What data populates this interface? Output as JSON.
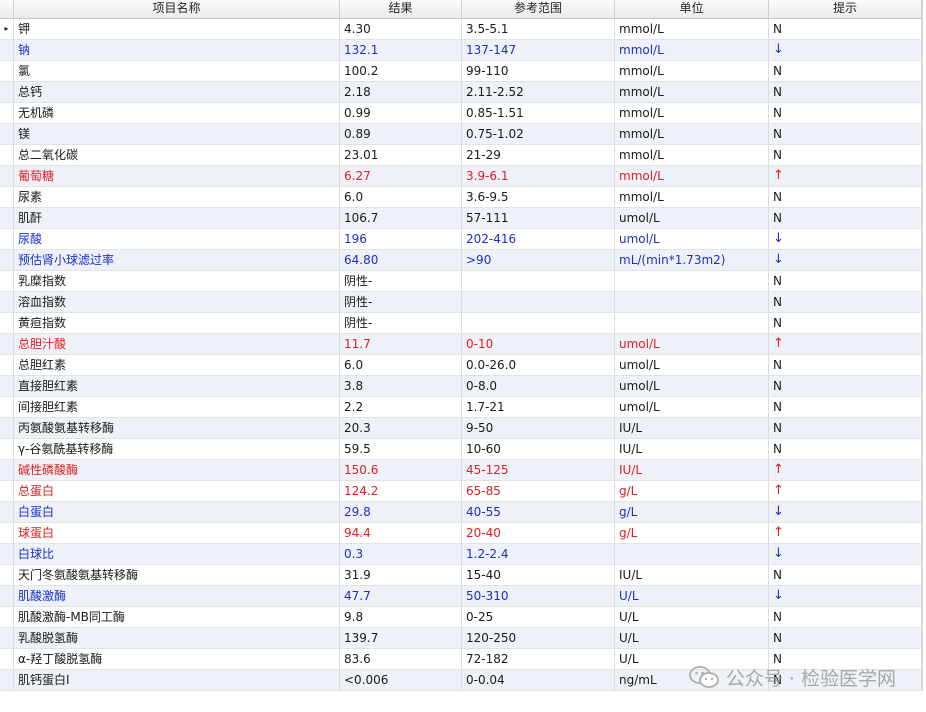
{
  "columns": {
    "name": "项目名称",
    "result": "结果",
    "reference": "参考范围",
    "unit": "单位",
    "hint": "提示"
  },
  "row_indicator": "▸",
  "rows": [
    {
      "name": "钾",
      "result": "4.30",
      "reference": "3.5-5.1",
      "unit": "mmol/L",
      "hint": "N",
      "flag": "normal"
    },
    {
      "name": "钠",
      "result": "132.1",
      "reference": "137-147",
      "unit": "mmol/L",
      "hint": "↓",
      "flag": "low"
    },
    {
      "name": "氯",
      "result": "100.2",
      "reference": "99-110",
      "unit": "mmol/L",
      "hint": "N",
      "flag": "normal"
    },
    {
      "name": "总钙",
      "result": "2.18",
      "reference": "2.11-2.52",
      "unit": "mmol/L",
      "hint": "N",
      "flag": "normal"
    },
    {
      "name": "无机磷",
      "result": "0.99",
      "reference": "0.85-1.51",
      "unit": "mmol/L",
      "hint": "N",
      "flag": "normal"
    },
    {
      "name": "镁",
      "result": "0.89",
      "reference": "0.75-1.02",
      "unit": "mmol/L",
      "hint": "N",
      "flag": "normal"
    },
    {
      "name": "总二氧化碳",
      "result": "23.01",
      "reference": "21-29",
      "unit": "mmol/L",
      "hint": "N",
      "flag": "normal"
    },
    {
      "name": "葡萄糖",
      "result": "6.27",
      "reference": "3.9-6.1",
      "unit": "mmol/L",
      "hint": "↑",
      "flag": "high"
    },
    {
      "name": "尿素",
      "result": "6.0",
      "reference": "3.6-9.5",
      "unit": "mmol/L",
      "hint": "N",
      "flag": "normal"
    },
    {
      "name": "肌酐",
      "result": "106.7",
      "reference": "57-111",
      "unit": "umol/L",
      "hint": "N",
      "flag": "normal"
    },
    {
      "name": "尿酸",
      "result": "196",
      "reference": "202-416",
      "unit": "umol/L",
      "hint": "↓",
      "flag": "low"
    },
    {
      "name": "预估肾小球滤过率",
      "result": "64.80",
      "reference": ">90",
      "unit": "mL/(min*1.73m2)",
      "hint": "↓",
      "flag": "low"
    },
    {
      "name": "乳糜指数",
      "result": "阴性-",
      "reference": "",
      "unit": "",
      "hint": "N",
      "flag": "normal"
    },
    {
      "name": "溶血指数",
      "result": "阴性-",
      "reference": "",
      "unit": "",
      "hint": "N",
      "flag": "normal"
    },
    {
      "name": "黄疸指数",
      "result": "阴性-",
      "reference": "",
      "unit": "",
      "hint": "N",
      "flag": "normal"
    },
    {
      "name": "总胆汁酸",
      "result": "11.7",
      "reference": "0-10",
      "unit": "umol/L",
      "hint": "↑",
      "flag": "high"
    },
    {
      "name": "总胆红素",
      "result": "6.0",
      "reference": "0.0-26.0",
      "unit": "umol/L",
      "hint": "N",
      "flag": "normal"
    },
    {
      "name": "直接胆红素",
      "result": "3.8",
      "reference": "0-8.0",
      "unit": "umol/L",
      "hint": "N",
      "flag": "normal"
    },
    {
      "name": "间接胆红素",
      "result": "2.2",
      "reference": "1.7-21",
      "unit": "umol/L",
      "hint": "N",
      "flag": "normal"
    },
    {
      "name": "丙氨酸氨基转移酶",
      "result": "20.3",
      "reference": "9-50",
      "unit": "IU/L",
      "hint": "N",
      "flag": "normal"
    },
    {
      "name": "γ-谷氨酰基转移酶",
      "result": "59.5",
      "reference": "10-60",
      "unit": "IU/L",
      "hint": "N",
      "flag": "normal"
    },
    {
      "name": "碱性磷酸酶",
      "result": "150.6",
      "reference": "45-125",
      "unit": "IU/L",
      "hint": "↑",
      "flag": "high"
    },
    {
      "name": "总蛋白",
      "result": "124.2",
      "reference": "65-85",
      "unit": "g/L",
      "hint": "↑",
      "flag": "high"
    },
    {
      "name": "白蛋白",
      "result": "29.8",
      "reference": "40-55",
      "unit": "g/L",
      "hint": "↓",
      "flag": "low"
    },
    {
      "name": "球蛋白",
      "result": "94.4",
      "reference": "20-40",
      "unit": "g/L",
      "hint": "↑",
      "flag": "high"
    },
    {
      "name": "白球比",
      "result": "0.3",
      "reference": "1.2-2.4",
      "unit": "",
      "hint": "↓",
      "flag": "low"
    },
    {
      "name": "天门冬氨酸氨基转移酶",
      "result": "31.9",
      "reference": "15-40",
      "unit": "IU/L",
      "hint": "N",
      "flag": "normal"
    },
    {
      "name": "肌酸激酶",
      "result": "47.7",
      "reference": "50-310",
      "unit": "U/L",
      "hint": "↓",
      "flag": "low"
    },
    {
      "name": "肌酸激酶-MB同工酶",
      "result": "9.8",
      "reference": "0-25",
      "unit": "U/L",
      "hint": "N",
      "flag": "normal"
    },
    {
      "name": "乳酸脱氢酶",
      "result": "139.7",
      "reference": "120-250",
      "unit": "U/L",
      "hint": "N",
      "flag": "normal"
    },
    {
      "name": "α-羟丁酸脱氢酶",
      "result": "83.6",
      "reference": "72-182",
      "unit": "U/L",
      "hint": "N",
      "flag": "normal"
    },
    {
      "name": "肌钙蛋白I",
      "result": "<0.006",
      "reference": "0-0.04",
      "unit": "ng/mL",
      "hint": "N",
      "flag": "normal"
    }
  ],
  "watermark": {
    "text": "公众号 · 检验医学网",
    "icon": "wechat-bubbles-icon",
    "color": "#9a9a9a"
  },
  "colors": {
    "low": "#1a2fc9",
    "high": "#e01e1e",
    "normal": "#1a1a1a",
    "alt_row": "#eef2f8"
  }
}
